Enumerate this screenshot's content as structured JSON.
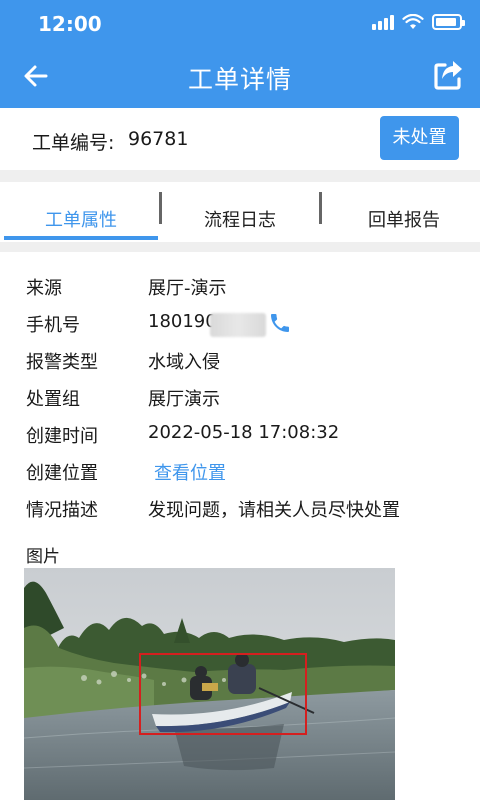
{
  "status_bar": {
    "time": "12:00"
  },
  "nav": {
    "title": "工单详情"
  },
  "order": {
    "label": "工单编号:",
    "number": "96781",
    "status_button": "未处置"
  },
  "tabs": [
    {
      "label": "工单属性",
      "active": true
    },
    {
      "label": "流程日志",
      "active": false
    },
    {
      "label": "回单报告",
      "active": false
    }
  ],
  "details": {
    "source": {
      "key": "来源",
      "value": "展厅-演示"
    },
    "phone": {
      "key": "手机号",
      "value": "180190"
    },
    "alarm_type": {
      "key": "报警类型",
      "value": "水域入侵"
    },
    "group": {
      "key": "处置组",
      "value": "展厅演示"
    },
    "created_time": {
      "key": "创建时间",
      "value": "2022-05-18 17:08:32"
    },
    "created_location": {
      "key": "创建位置",
      "value": "查看位置"
    },
    "description": {
      "key": "情况描述",
      "value": "发现问题，请相关人员尽快处置"
    }
  },
  "picture": {
    "label": "图片"
  },
  "colors": {
    "accent": "#3f96ec",
    "detection_box": "#d51f1f"
  }
}
